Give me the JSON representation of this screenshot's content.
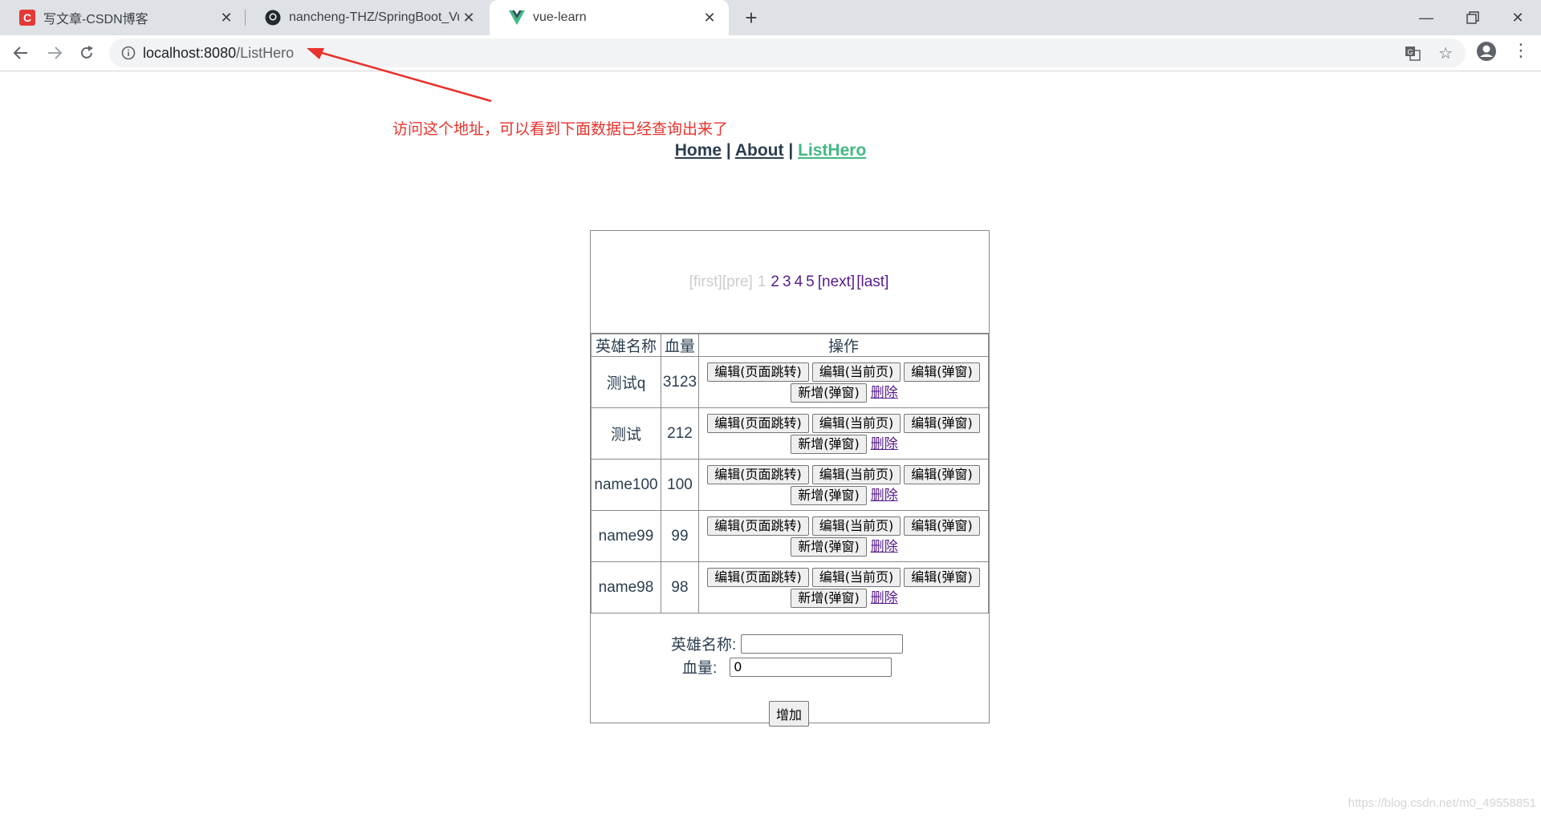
{
  "browser": {
    "tabs": [
      {
        "title": "写文章-CSDN博客",
        "active": false
      },
      {
        "title": "nancheng-THZ/SpringBoot_Vu",
        "active": false
      },
      {
        "title": "vue-learn",
        "active": true
      }
    ],
    "url_host": "localhost:8080",
    "url_path": "/ListHero",
    "new_tab_glyph": "+",
    "icons": [
      "back-icon",
      "forward-icon",
      "reload-icon",
      "info-icon",
      "translate-icon",
      "star-icon",
      "profile-icon",
      "menu-icon",
      "minimize-icon",
      "maximize-icon",
      "close-icon"
    ]
  },
  "annotation": {
    "text": "访问这个地址，可以看到下面数据已经查询出来了",
    "color": "#e8322c"
  },
  "nav": {
    "home": "Home",
    "about": "About",
    "listhero": "ListHero",
    "sep": "|",
    "active_color": "#42b983"
  },
  "pager": {
    "first": "[first]",
    "pre": "[pre]",
    "current": "1",
    "pages": [
      "2",
      "3",
      "4",
      "5"
    ],
    "next": "[next]",
    "last": "[last]"
  },
  "table": {
    "headers": [
      "英雄名称",
      "血量",
      "操作"
    ],
    "rows": [
      {
        "name": "测试q",
        "hp": "3123"
      },
      {
        "name": "测试",
        "hp": "212"
      },
      {
        "name": "name100",
        "hp": "100"
      },
      {
        "name": "name99",
        "hp": "99"
      },
      {
        "name": "name98",
        "hp": "98"
      }
    ],
    "actions": {
      "edit_page": "编辑(页面跳转)",
      "edit_current": "编辑(当前页)",
      "edit_popup": "编辑(弹窗)",
      "add_popup": "新增(弹窗)",
      "delete": "删除"
    }
  },
  "form": {
    "name_label": "英雄名称:",
    "name_value": "",
    "hp_label": "血量:",
    "hp_value": "0",
    "add_button": "增加"
  },
  "watermark": "https://blog.csdn.net/m0_49558851"
}
